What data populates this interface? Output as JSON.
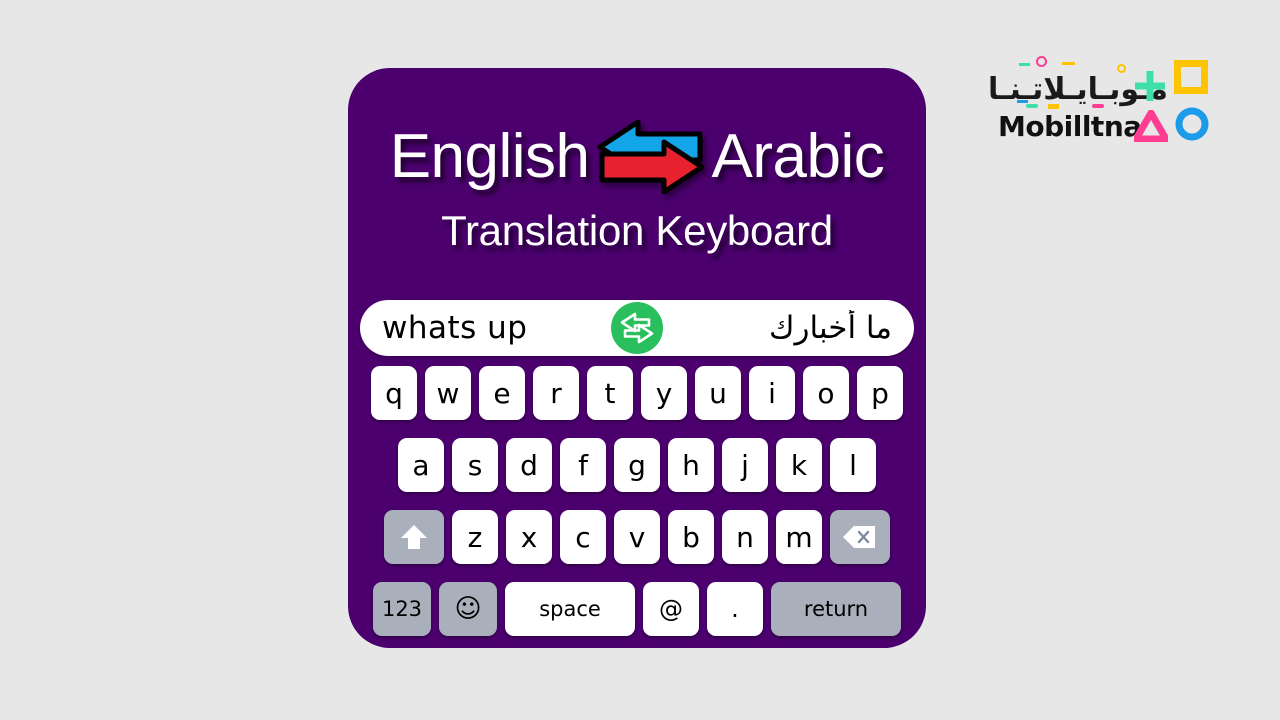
{
  "page": {
    "background_color": "#e7e7e7"
  },
  "card": {
    "background_color": "#4b006e"
  },
  "title": {
    "left_language": "English",
    "right_language": "Arabic",
    "subtitle": "Translation Keyboard",
    "arrow_left_color": "#12a5e8",
    "arrow_right_color": "#e8212f",
    "arrow_outline_color": "#000000",
    "text_color": "#ffffff"
  },
  "translation_bar": {
    "source_text": "whats  up",
    "translated_text": "ما أخبارك",
    "swap_button_color": "#28bf5c",
    "swap_icon_name": "swap-horizontal-icon",
    "background_color": "#ffffff"
  },
  "keyboard": {
    "row1": [
      "q",
      "w",
      "e",
      "r",
      "t",
      "y",
      "u",
      "i",
      "o",
      "p"
    ],
    "row2": [
      "a",
      "s",
      "d",
      "f",
      "g",
      "h",
      "j",
      "k",
      "l"
    ],
    "row3": [
      "z",
      "x",
      "c",
      "v",
      "b",
      "n",
      "m"
    ],
    "shift_label": "",
    "backspace_label": "",
    "numbers_label": "123",
    "emoji_label": "☺",
    "space_label": "space",
    "at_label": "@",
    "period_label": ".",
    "return_label": "return",
    "key_color": "#ffffff",
    "function_key_color": "#aab0bb"
  },
  "brand": {
    "arabic_name": "مـوبـايـلاتـنـا",
    "latin_name": "Mobilltna",
    "shape_colors": {
      "plus": "#3fe0a8",
      "square": "#ffc400",
      "triangle": "#ff3d91",
      "circle": "#1b9bea"
    }
  }
}
